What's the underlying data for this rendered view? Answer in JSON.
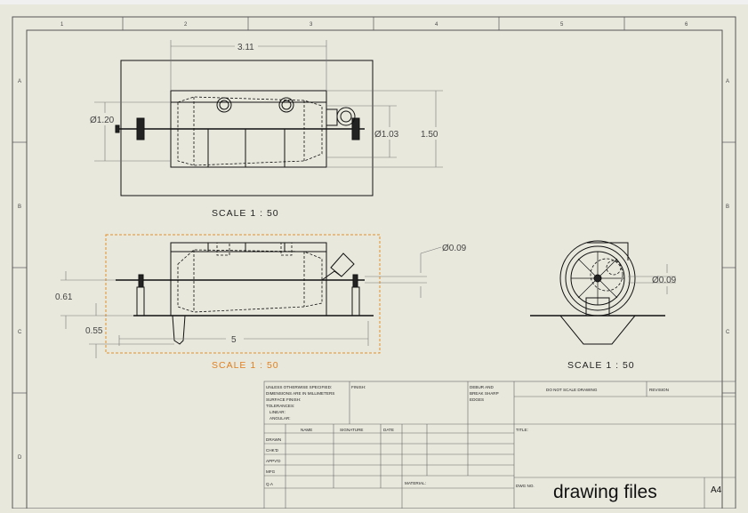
{
  "zone_numbers": [
    "1",
    "2",
    "3",
    "4",
    "5",
    "6"
  ],
  "zone_letters": [
    "A",
    "B",
    "C",
    "D"
  ],
  "top_view": {
    "scale_label": "SCALE 1 : 50",
    "dim_width": "3.11",
    "dim_left_dia": "Ø1.20",
    "dim_right_dia": "Ø1.03",
    "dim_height": "1.50"
  },
  "front_view": {
    "scale_label": "SCALE 1 : 50",
    "dim_pipe_dia": "Ø0.09",
    "dim_height_a": "0.61",
    "dim_height_b": "0.55",
    "dim_length": "5"
  },
  "side_view": {
    "scale_label": "SCALE 1 : 50",
    "dim_dia": "Ø0.09"
  },
  "title_block": {
    "unless_lines": [
      "UNLESS OTHERWISE SPECIFIED:",
      "DIMENSIONS ARE IN MILLIMETERS",
      "SURFACE FINISH:",
      "TOLERANCES:",
      "LINEAR:",
      "ANGULAR:"
    ],
    "finish_label": "FINISH:",
    "deburr_lines": [
      "DEBUR AND",
      "BREAK SHARP",
      "EDGES"
    ],
    "do_not_scale": "DO NOT SCALE DRAWING",
    "revision_label": "REVISION",
    "col_name": "NAME",
    "col_signature": "SIGNATURE",
    "col_date": "DATE",
    "row_labels": [
      "DRAWN",
      "CHK'D",
      "APPV'D",
      "MFG",
      "Q.A"
    ],
    "title_label": "TITLE:",
    "material_label": "MATERIAL:",
    "dwg_no_label": "DWG NO.",
    "drawing_title": "drawing files",
    "sheet_size": "A4"
  }
}
